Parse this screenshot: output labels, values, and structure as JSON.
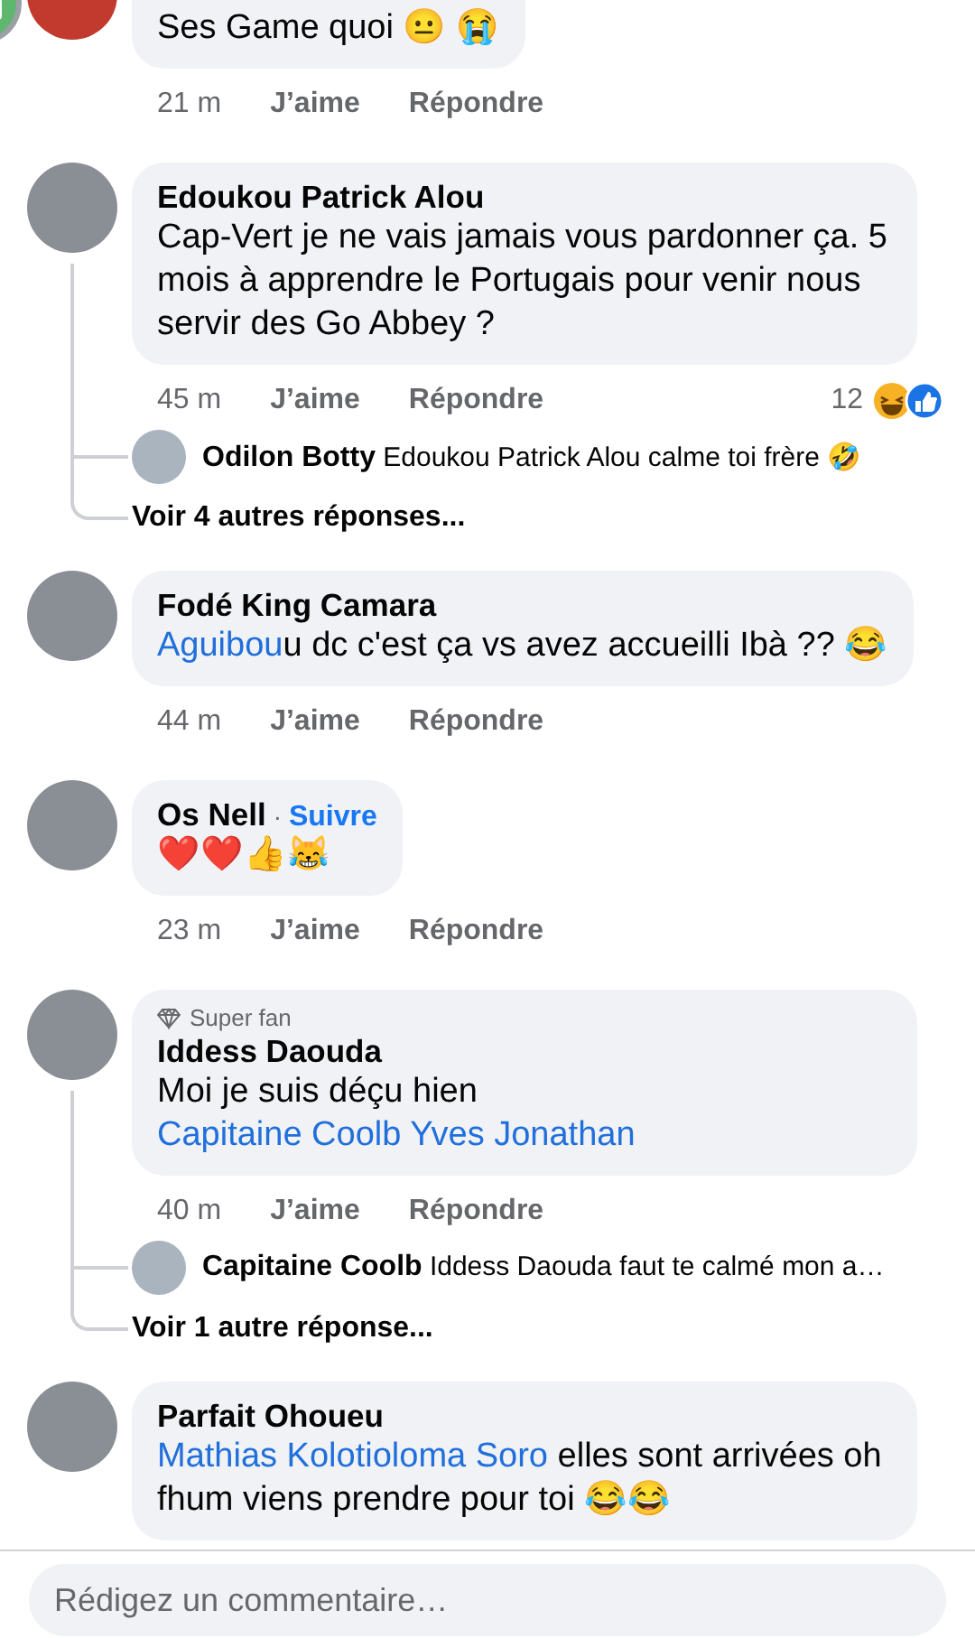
{
  "comments": [
    {
      "cut_top": true,
      "segments": [
        {
          "kind": "plain",
          "text": "Ses Game quoi 😐 😭"
        }
      ],
      "time": "21 m",
      "like": "J’aime",
      "reply": "Répondre"
    },
    {
      "author": "Edoukou Patrick Alou",
      "segments": [
        {
          "kind": "plain",
          "text": "Cap-Vert je ne vais jamais vous pardonner ça. 5 mois à apprendre le Portugais pour venir nous servir des Go Abbey ?"
        }
      ],
      "time": "45 m",
      "like": "J’aime",
      "reply": "Répondre",
      "reactions": {
        "count": "12"
      },
      "replies": [
        {
          "author": "Odilon Botty",
          "text": "Edoukou Patrick Alou calme toi frère 🤣"
        }
      ],
      "more_replies": "Voir 4 autres réponses..."
    },
    {
      "author": "Fodé King Camara",
      "segments": [
        {
          "kind": "mention",
          "text": "Aguibou"
        },
        {
          "kind": "plain",
          "text": "u dc c'est ça vs avez accueilli Ibà ?? 😂"
        }
      ],
      "time": "44 m",
      "like": "J’aime",
      "reply": "Répondre"
    },
    {
      "author": "Os Nell",
      "separator": "·",
      "follow": "Suivre",
      "segments": [
        {
          "kind": "plain",
          "text": "❤️❤️👍😹"
        }
      ],
      "time": "23 m",
      "like": "J’aime",
      "reply": "Répondre"
    },
    {
      "badge": "Super fan",
      "author": "Iddess Daouda",
      "segments": [
        {
          "kind": "plain",
          "text": "Moi je suis déçu hien "
        },
        {
          "kind": "mention",
          "text": "Capitaine Coolb Yves Jonathan"
        }
      ],
      "time": "40 m",
      "like": "J’aime",
      "reply": "Répondre",
      "replies": [
        {
          "author": "Capitaine Coolb",
          "text": "Iddess Daouda faut te calmé  mon a…"
        }
      ],
      "more_replies": "Voir 1 autre réponse..."
    },
    {
      "author": "Parfait Ohoueu",
      "segments": [
        {
          "kind": "mention",
          "text": "Mathias Kolotioloma Soro"
        },
        {
          "kind": "plain",
          "text": "  elles  sont arrivées oh fhum viens prendre pour toi 😂😂"
        }
      ]
    }
  ],
  "composer": {
    "placeholder": "Rédigez un commentaire…"
  }
}
